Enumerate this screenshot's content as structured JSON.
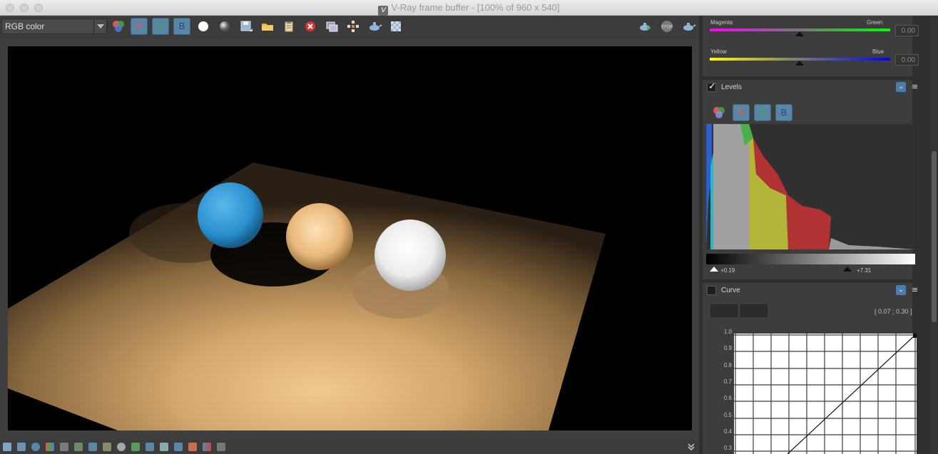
{
  "window": {
    "title": "V-Ray frame buffer - [100% of 960 x 540]",
    "logo_glyph": "V"
  },
  "toolbar": {
    "channel_select_value": "RGB color",
    "buttons": [
      {
        "name": "color-mode-icon"
      },
      {
        "name": "red-channel-button",
        "label": "R"
      },
      {
        "name": "green-channel-button",
        "label": "G"
      },
      {
        "name": "blue-channel-button",
        "label": "B"
      },
      {
        "name": "white-display-icon"
      },
      {
        "name": "gray-display-icon"
      },
      {
        "name": "save-icon"
      },
      {
        "name": "open-folder-icon"
      },
      {
        "name": "clipboard-icon"
      },
      {
        "name": "clear-icon"
      },
      {
        "name": "duplicate-icon"
      },
      {
        "name": "track-mouse-icon"
      },
      {
        "name": "render-region-icon"
      },
      {
        "name": "checker-icon"
      },
      {
        "name": "render-teapot-icon"
      },
      {
        "name": "stop-icon",
        "label": "STOP"
      },
      {
        "name": "render-interactive-icon"
      }
    ]
  },
  "color_balance": {
    "rows": [
      {
        "left_label": "Magenta",
        "right_label": "Green",
        "value": "0.00",
        "position": 0.5,
        "colors": [
          "#ff00ff",
          "#00ff00"
        ]
      },
      {
        "left_label": "Yellow",
        "right_label": "Blue",
        "value": "0.00",
        "position": 0.5,
        "colors": [
          "#ffff00",
          "#0000ff"
        ]
      }
    ]
  },
  "levels": {
    "title": "Levels",
    "enabled": true,
    "channel_buttons": [
      "R",
      "G",
      "B"
    ],
    "low_label": "+0.19",
    "high_label": "+7.31",
    "low_position": 0.02,
    "high_position": 0.67
  },
  "curve": {
    "title": "Curve",
    "enabled": false,
    "coordinate_readout": "[ 0.07 ; 0.30 ]",
    "y_axis_labels": [
      "1.0",
      "0.9",
      "0.8",
      "0.7",
      "0.6",
      "0.5",
      "0.4",
      "0.3"
    ]
  },
  "bottombar": {
    "icon_count": 20
  }
}
